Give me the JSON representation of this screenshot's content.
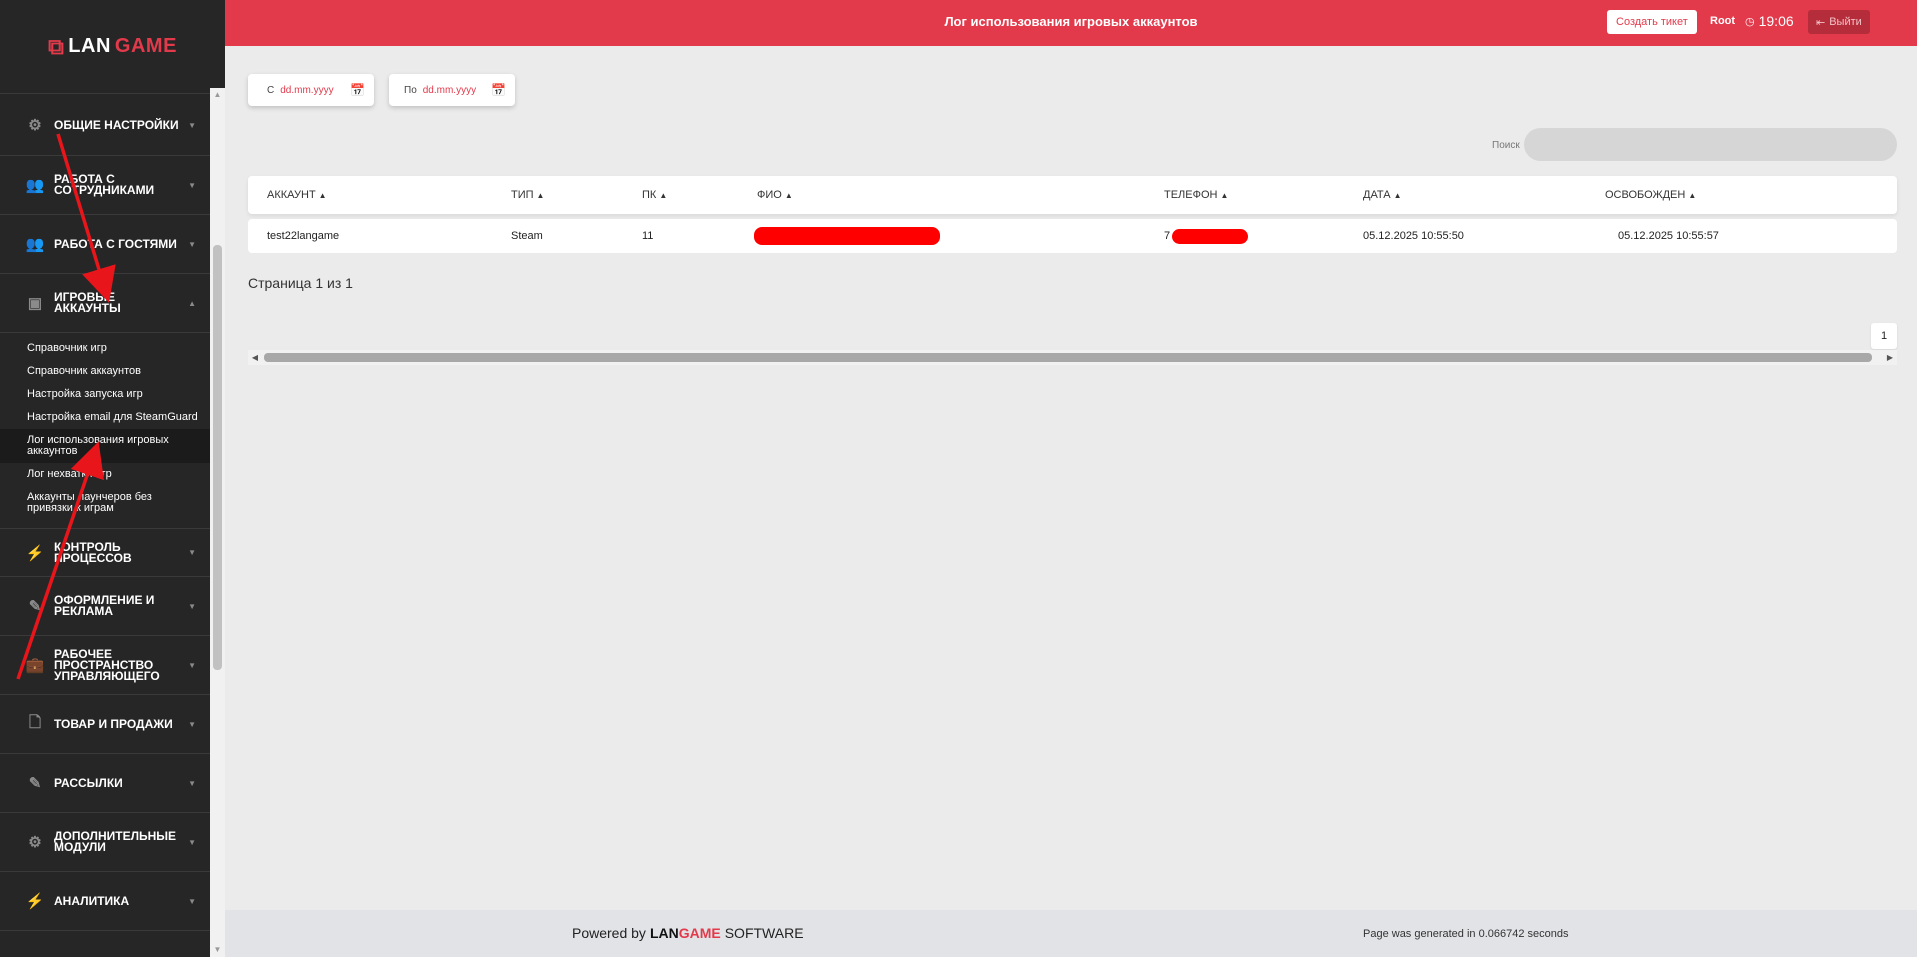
{
  "logo": {
    "lan": "LAN",
    "game": "GAME"
  },
  "sidebar": {
    "sections": [
      {
        "label": "ОБЩИЕ НАСТРОЙКИ",
        "icon": "gear-icon"
      },
      {
        "label": "РАБОТА С СОТРУДНИКАМИ",
        "icon": "users-icon"
      },
      {
        "label": "РАБОТА С ГОСТЯМИ",
        "icon": "users-icon"
      },
      {
        "label": "ИГРОВЫЕ АККАУНТЫ",
        "icon": "id-card-icon",
        "expanded": true
      },
      {
        "label": "КОНТРОЛЬ ПРОЦЕССОВ",
        "icon": "bolt-icon"
      },
      {
        "label": "ОФОРМЛЕНИЕ И РЕКЛАМА",
        "icon": "edit-icon"
      },
      {
        "label": "РАБОЧЕЕ ПРОСТРАНСТВО УПРАВЛЯЮЩЕГО",
        "icon": "briefcase-icon"
      },
      {
        "label": "ТОВАР И ПРОДАЖИ",
        "icon": "note-icon"
      },
      {
        "label": "РАССЫЛКИ",
        "icon": "edit-icon"
      },
      {
        "label": "ДОПОЛНИТЕЛЬНЫЕ МОДУЛИ",
        "icon": "gear-icon"
      },
      {
        "label": "АНАЛИТИКА",
        "icon": "bolt-icon"
      }
    ],
    "sub_items": [
      "Справочник игр",
      "Справочник аккаунтов",
      "Настройка запуска игр",
      "Настройка email для SteamGuard",
      "Лог использования игровых аккаунтов",
      "Лог нехватки игр",
      "Аккаунты лаунчеров без привязки к играм"
    ],
    "active_sub": "Лог использования игровых аккаунтов"
  },
  "topbar": {
    "title": "Лог использования игровых аккаунтов",
    "create_ticket": "Создать тикет",
    "user": "Root",
    "time": "19:06",
    "logout": "Выйти"
  },
  "filters": {
    "from_prefix": "С",
    "from_value": "dd.mm.yyyy",
    "to_prefix": "По",
    "to_value": "dd.mm.yyyy",
    "search_label": "Поиск",
    "search_value": ""
  },
  "table": {
    "columns": [
      "АККАУНТ",
      "ТИП",
      "ПК",
      "ФИО",
      "ТЕЛЕФОН",
      "ДАТА",
      "ОСВОБОЖДЕН"
    ],
    "rows": [
      {
        "account": "test22langame",
        "type": "Steam",
        "pc": "11",
        "fio": "",
        "phone_prefix": "7",
        "date": "05.12.2025 10:55:50",
        "released": "05.12.2025 10:55:57"
      }
    ]
  },
  "pagination": {
    "info": "Страница 1 из 1",
    "current": "1"
  },
  "footer": {
    "powered_by": "Powered by",
    "brand_lan": "LAN",
    "brand_game": "GAME",
    "software": "SOFTWARE",
    "generated": "Page was generated in 0.066742 seconds"
  },
  "colors": {
    "accent": "#e23a4b",
    "sidebar_bg": "#262626",
    "redaction": "#ff0000"
  }
}
